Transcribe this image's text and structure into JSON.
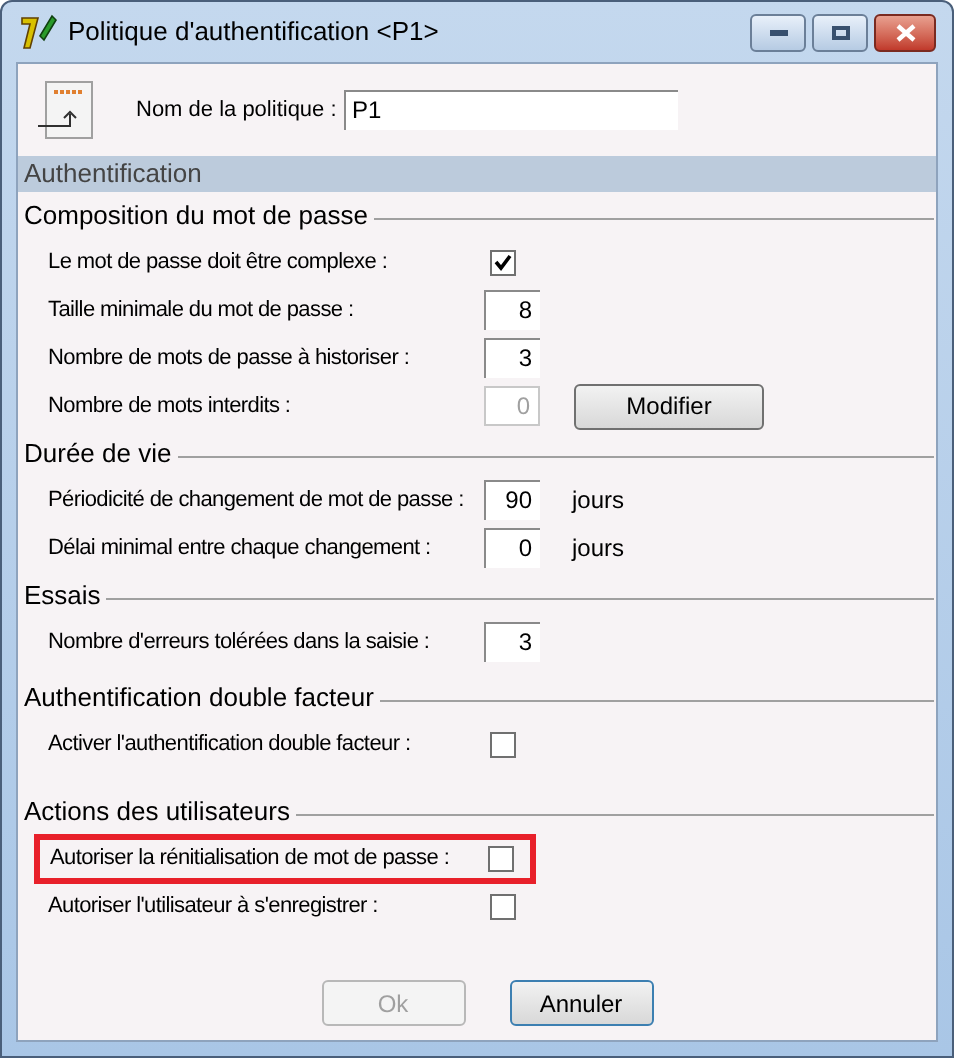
{
  "window": {
    "title": "Politique d'authentification <P1>"
  },
  "policy": {
    "label": "Nom de la politique :",
    "value": "P1"
  },
  "band": "Authentification",
  "sections": [
    {
      "title": "Composition du mot de passe",
      "rows": [
        {
          "kind": "checkbox",
          "label": "Le mot de passe doit être complexe :",
          "checked": true,
          "highlighted": false
        },
        {
          "kind": "number",
          "label": "Taille minimale du mot de passe :",
          "value": "8",
          "disabled": false,
          "highlighted": false
        },
        {
          "kind": "number",
          "label": "Nombre de mots de passe à historiser :",
          "value": "3",
          "disabled": false,
          "highlighted": false
        },
        {
          "kind": "number_button",
          "label": "Nombre de mots interdits :",
          "value": "0",
          "disabled": true,
          "button": "Modifier",
          "highlighted": false
        }
      ]
    },
    {
      "title": "Durée de vie",
      "rows": [
        {
          "kind": "number_unit",
          "label": "Périodicité de changement de mot de passe :",
          "value": "90",
          "disabled": false,
          "unit": "jours",
          "highlighted": false
        },
        {
          "kind": "number_unit",
          "label": "Délai minimal entre chaque changement :",
          "value": "0",
          "disabled": false,
          "unit": "jours",
          "highlighted": false
        }
      ]
    },
    {
      "title": "Essais",
      "rows": [
        {
          "kind": "number",
          "label": "Nombre d'erreurs tolérées dans la saisie :",
          "value": "3",
          "disabled": false,
          "highlighted": false
        }
      ]
    },
    {
      "title": "Authentification double facteur",
      "rows": [
        {
          "kind": "checkbox",
          "label": "Activer l'authentification double facteur :",
          "checked": false,
          "highlighted": false
        }
      ]
    },
    {
      "title": "Actions des utilisateurs",
      "rows": [
        {
          "kind": "checkbox",
          "label": "Autoriser la rénitialisation de mot de passe :",
          "checked": false,
          "highlighted": true
        },
        {
          "kind": "checkbox",
          "label": "Autoriser l'utilisateur à s'enregistrer :",
          "checked": false,
          "highlighted": false
        }
      ]
    }
  ],
  "buttons": [
    {
      "label": "Ok",
      "disabled": true
    },
    {
      "label": "Annuler",
      "disabled": false
    }
  ]
}
